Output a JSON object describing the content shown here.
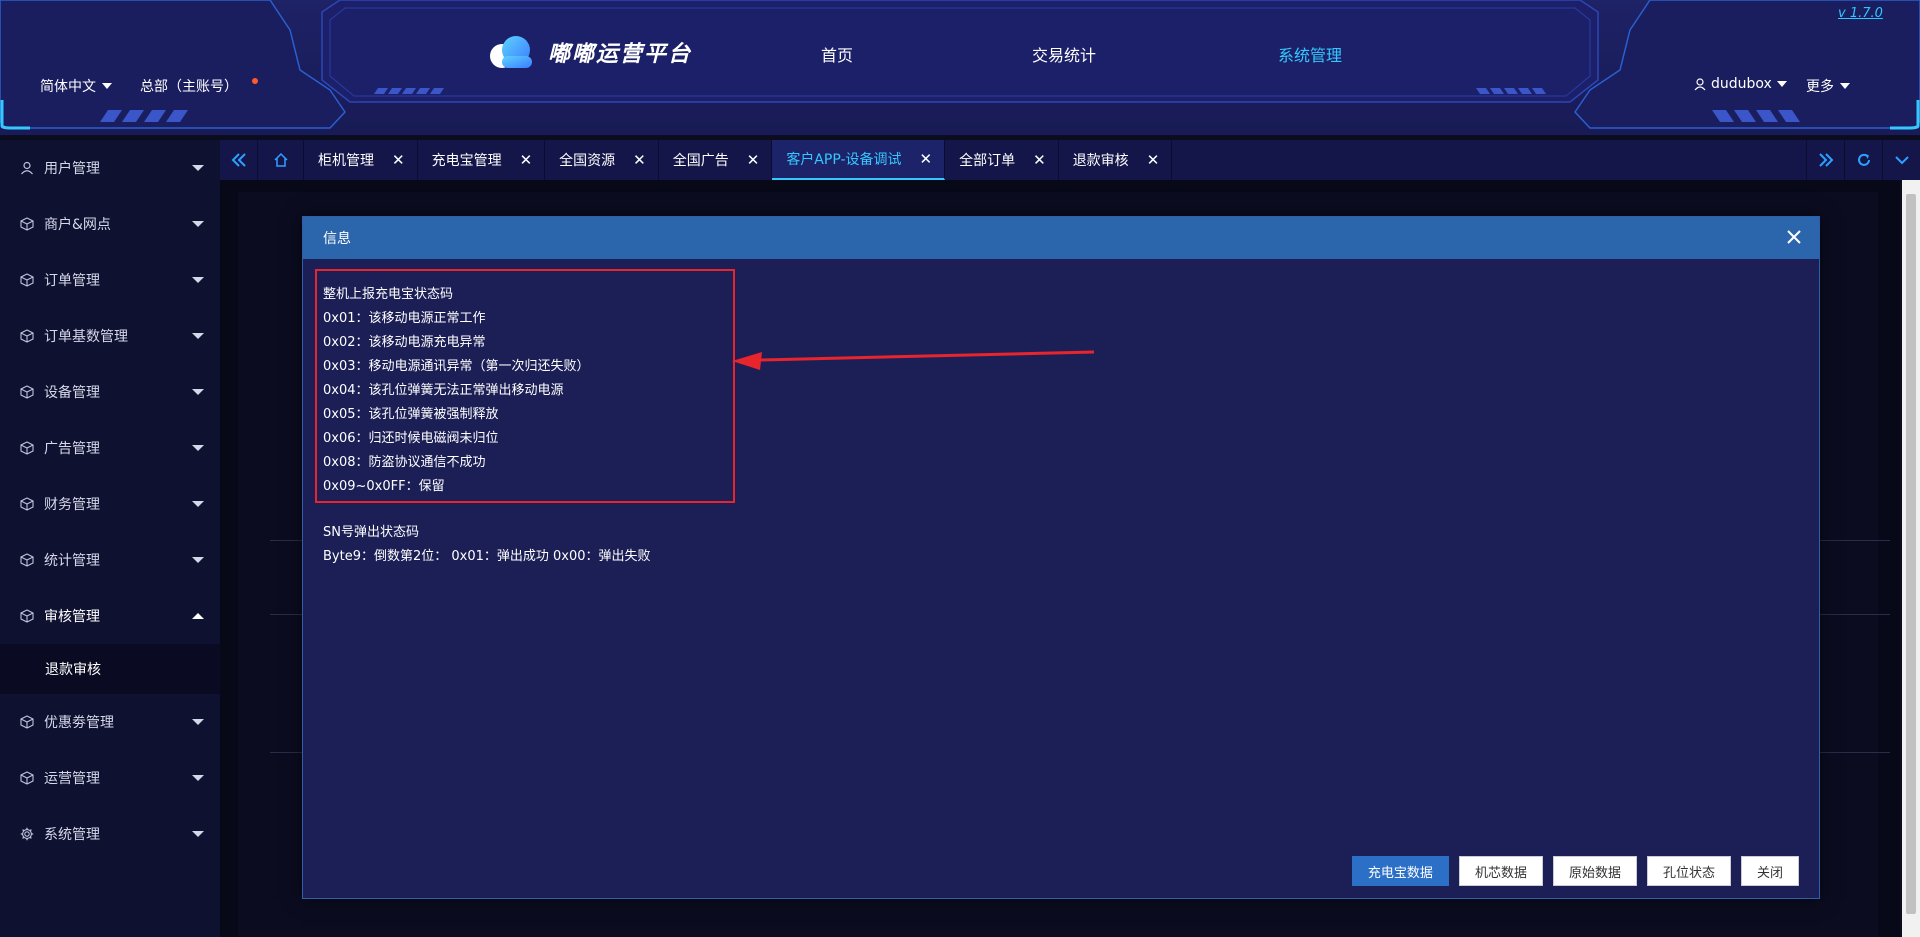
{
  "header": {
    "brand": "嘟嘟运营平台",
    "version": "v 1.7.0",
    "nav": [
      "首页",
      "交易统计",
      "系统管理"
    ],
    "active_nav": "系统管理",
    "language": "简体中文",
    "account": "总部（主账号）",
    "username": "dudubox",
    "more": "更多"
  },
  "sidebar": {
    "items": [
      {
        "label": "用户管理",
        "icon": "user-icon"
      },
      {
        "label": "商户&网点",
        "icon": "cube-icon"
      },
      {
        "label": "订单管理",
        "icon": "cube-icon"
      },
      {
        "label": "订单基数管理",
        "icon": "cube-icon"
      },
      {
        "label": "设备管理",
        "icon": "cube-icon"
      },
      {
        "label": "广告管理",
        "icon": "cube-icon"
      },
      {
        "label": "财务管理",
        "icon": "cube-icon"
      },
      {
        "label": "统计管理",
        "icon": "cube-icon"
      },
      {
        "label": "审核管理",
        "icon": "cube-icon",
        "open": true,
        "children": [
          "退款审核"
        ]
      },
      {
        "label": "优惠劵管理",
        "icon": "cube-icon"
      },
      {
        "label": "运营管理",
        "icon": "cube-icon"
      },
      {
        "label": "系统管理",
        "icon": "gear-icon"
      }
    ]
  },
  "tabs": {
    "items": [
      "柜机管理",
      "充电宝管理",
      "全国资源",
      "全国广告",
      "客户APP-设备调试",
      "全部订单",
      "退款审核"
    ],
    "active": "客户APP-设备调试"
  },
  "modal": {
    "title": "信息",
    "status_codes": [
      "整机上报充电宝状态码",
      "0x01：该移动电源正常工作",
      "0x02：该移动电源充电异常",
      "0x03：移动电源通讯异常（第一次归还失败）",
      "0x04：该孔位弹簧无法正常弹出移动电源",
      "0x05：该孔位弹簧被强制释放",
      "0x06：归还时候电磁阀未归位",
      "0x08：防盗协议通信不成功",
      "0x09~0x0FF：保留"
    ],
    "sn_lines": [
      "SN号弹出状态码",
      "Byte9：倒数第2位： 0x01：弹出成功 0x00：弹出失败"
    ],
    "buttons": [
      "充电宝数据",
      "机芯数据",
      "原始数据",
      "孔位状态",
      "关闭"
    ]
  },
  "colors": {
    "accent": "#35c8ff",
    "primary_button": "#2b6fc7",
    "annotation_red": "#e8242c",
    "modal_header": "#2b66ad"
  }
}
